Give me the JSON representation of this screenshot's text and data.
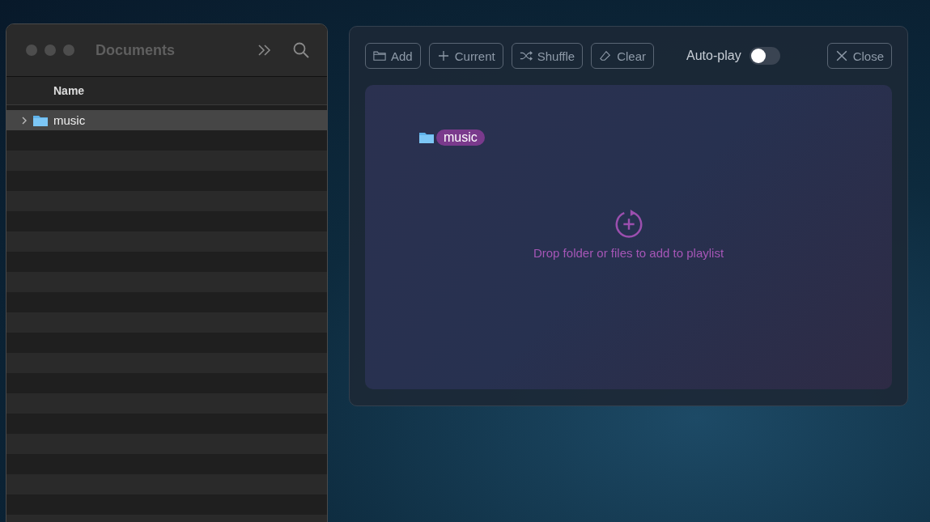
{
  "finder": {
    "title": "Documents",
    "column_header": "Name",
    "items": [
      {
        "name": "music",
        "expanded": false,
        "selected": true
      }
    ]
  },
  "player": {
    "toolbar": [
      {
        "kind": "add",
        "label": "Add"
      },
      {
        "kind": "current",
        "label": "Current"
      },
      {
        "kind": "shuffle",
        "label": "Shuffle"
      },
      {
        "kind": "clear",
        "label": "Clear"
      }
    ],
    "autoplay": {
      "label": "Auto-play",
      "on": false
    },
    "close": {
      "label": "Close"
    },
    "drop_zone": {
      "dragged_item": "music",
      "hint": "Drop folder or files to add to playlist"
    }
  }
}
